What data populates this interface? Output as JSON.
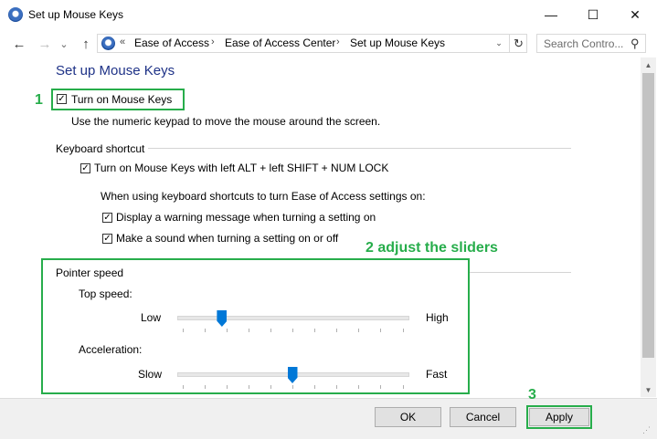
{
  "window": {
    "title": "Set up Mouse Keys",
    "minimize_glyph": "—",
    "maximize_glyph": "☐",
    "close_glyph": "✕"
  },
  "nav": {
    "back_glyph": "←",
    "forward_glyph": "→",
    "recent_glyph": "⌄",
    "up_glyph": "↑"
  },
  "address": {
    "overflow": "«",
    "crumbs": [
      "Ease of Access",
      "Ease of Access Center",
      "Set up Mouse Keys"
    ],
    "separator": "›",
    "dropdown_glyph": "⌄",
    "refresh_glyph": "↻"
  },
  "search": {
    "placeholder": "Search Contro...",
    "icon_glyph": "⚲"
  },
  "content": {
    "page_title": "Set up Mouse Keys",
    "turn_on": {
      "label": "Turn on Mouse Keys",
      "checked": true
    },
    "turn_on_desc": "Use the numeric keypad to move the mouse around the screen.",
    "keyboard_shortcut": {
      "heading": "Keyboard shortcut",
      "shortcut_option": {
        "label": "Turn on Mouse Keys with left ALT + left SHIFT + NUM LOCK",
        "checked": true
      },
      "sub_heading": "When using keyboard shortcuts to turn Ease of Access settings on:",
      "warning_option": {
        "label": "Display a warning message when turning a setting on",
        "checked": true
      },
      "sound_option": {
        "label": "Make a sound when turning a setting on or off",
        "checked": true
      }
    },
    "pointer_speed": {
      "heading": "Pointer speed",
      "top_speed": {
        "label": "Top speed:",
        "min_label": "Low",
        "max_label": "High",
        "value": 0.18
      },
      "acceleration": {
        "label": "Acceleration:",
        "min_label": "Slow",
        "max_label": "Fast",
        "value": 0.5
      }
    },
    "check_glyph": "✓"
  },
  "annotations": {
    "step1": "1",
    "step2": "2 adjust the sliders",
    "step3": "3",
    "color": "#27ad4b"
  },
  "buttons": {
    "ok": "OK",
    "cancel": "Cancel",
    "apply": "Apply"
  },
  "colors": {
    "title_blue": "#1e3287",
    "slider_thumb": "#0078d7",
    "annotation_green": "#27ad4b"
  }
}
